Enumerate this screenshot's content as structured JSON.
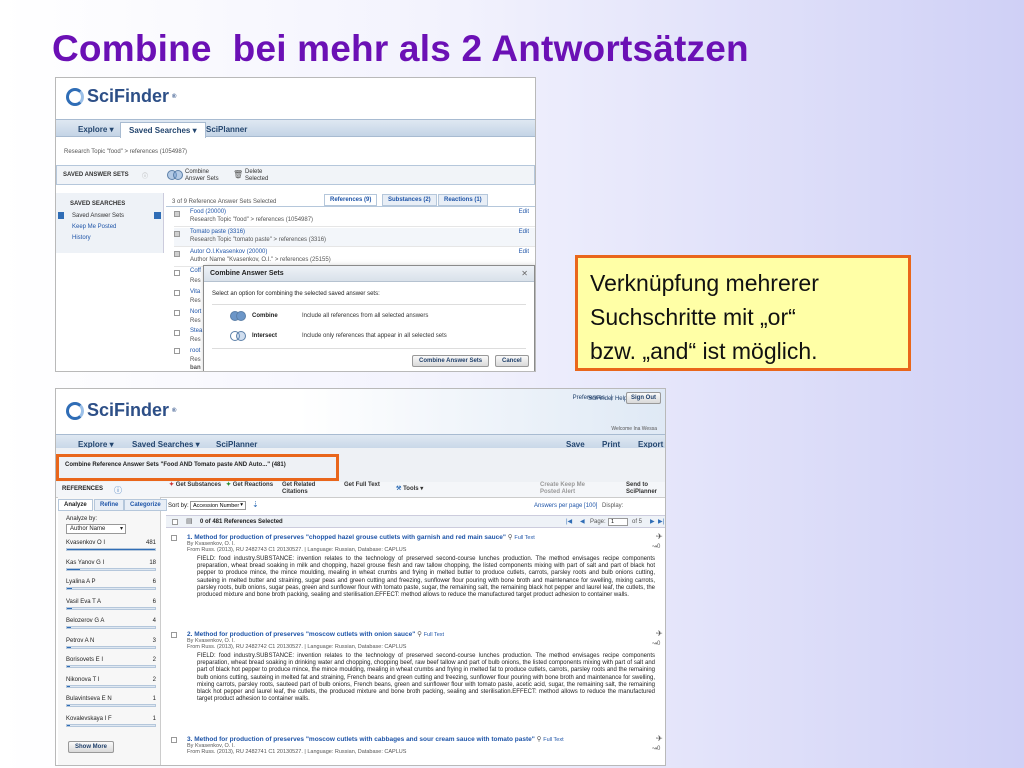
{
  "slide": {
    "title": "Combine  bei mehr als 2 Antwortsätzen",
    "note_lines": [
      "Verknüpfung mehrerer",
      "Suchschritte mit „or“",
      "bzw. „and“ ist möglich."
    ]
  },
  "brand": {
    "name": "SciFinder",
    "reg": "®"
  },
  "shot1": {
    "nav": [
      "Explore ▾",
      "Saved Searches ▾",
      "SciPlanner"
    ],
    "breadcrumb": "Research Topic \"food\" > references (1054987)",
    "section_label": "SAVED ANSWER SETS",
    "combine_tool": "Combine Answer Sets",
    "delete_tool": "Delete Selected",
    "sidebar_heading": "SAVED SEARCHES",
    "sidebar_items": [
      "Saved Answer Sets",
      "Keep Me Posted",
      "History"
    ],
    "selected_count": "3 of 9 Reference Answer Sets Selected",
    "tabs": [
      "References (9)",
      "Substances (2)",
      "Reactions (1)"
    ],
    "rows": [
      {
        "title": "Food (20000)",
        "sub": "Research Topic \"food\" > references (1054987)",
        "edit": "Edit"
      },
      {
        "title": "Tomato paste (3316)",
        "sub": "Research Topic \"tomato paste\" > references (3316)",
        "edit": "Edit"
      },
      {
        "title": "Autor O.I.Kvasenkov (20000)",
        "sub": "Author Name \"Kvasenkov, O.I.\" > references (25155)",
        "edit": "Edit"
      }
    ],
    "partial_rows": [
      "Coff",
      "Res",
      "Vita",
      "Res",
      "Nort",
      "Res",
      "Stea",
      "Res",
      "root",
      "Res",
      "ban"
    ],
    "dialog": {
      "title": "Combine Answer Sets",
      "prompt": "Select an option for combining the selected saved answer sets:",
      "options": [
        {
          "label": "Combine",
          "desc": "Include all references from all selected answers"
        },
        {
          "label": "Intersect",
          "desc": "Include only references that appear in all selected sets"
        }
      ],
      "primary": "Combine Answer Sets",
      "cancel": "Cancel"
    }
  },
  "shot2": {
    "top_links": [
      "Preferences",
      "|",
      "SciFinder Help ▾"
    ],
    "signout": "Sign Out",
    "nav": [
      "Explore ▾",
      "Saved Searches ▾",
      "SciPlanner"
    ],
    "right_nav": [
      "Save",
      "Print",
      "Export"
    ],
    "welcome": "Welcome Ina Wessa",
    "context": "Combine Reference Answer Sets \"Food AND Tomato paste AND Auto...\" (481)",
    "references_label": "REFERENCES",
    "tools": [
      "Get Substances",
      "Get Reactions",
      "Get Related Citations",
      "Get Full Text",
      "Tools ▾"
    ],
    "right_tools": [
      "Create Keep Me Posted Alert",
      "Send to SciPlanner"
    ],
    "left_tabs": [
      "Analyze",
      "Refine",
      "Categorize"
    ],
    "analyze_by": "Analyze by:",
    "analyze_value": "Author Name",
    "authors": [
      {
        "name": "Kvasenkov O I",
        "count": "481",
        "pct": 1.0
      },
      {
        "name": "Kas Yanov G I",
        "count": "18",
        "pct": 0.15
      },
      {
        "name": "Lyalina A P",
        "count": "6",
        "pct": 0.06
      },
      {
        "name": "Vasil Eva T A",
        "count": "6",
        "pct": 0.06
      },
      {
        "name": "Belozerov G A",
        "count": "4",
        "pct": 0.05
      },
      {
        "name": "Petrov A N",
        "count": "3",
        "pct": 0.04
      },
      {
        "name": "Borisovets E I",
        "count": "2",
        "pct": 0.03
      },
      {
        "name": "Nikonova T I",
        "count": "2",
        "pct": 0.03
      },
      {
        "name": "Bulavintseva E N",
        "count": "1",
        "pct": 0.02
      },
      {
        "name": "Kovalevskaya I F",
        "count": "1",
        "pct": 0.02
      }
    ],
    "show_more": "Show More",
    "sort_label": "Sort by:",
    "sort_value": "Accession Number",
    "answers_label": "Answers per page [100]",
    "display_label": "Display:",
    "page_label": "Page:",
    "page_value": "1",
    "page_of": "of 5",
    "selected": "0 of 481 References Selected",
    "records": [
      {
        "num": "1.",
        "title": "Method for production of preserves \"chopped hazel grouse cutlets with garnish and red main sauce\"",
        "fulltext": "Full Text",
        "by": "By Kvasenkov, O. I.",
        "from": "From Russ. (2013), RU 2482743 C1 20130527.  |  Language: Russian, Database: CAPLUS",
        "abstract": "FIELD: food industry.SUBSTANCE: invention relates to the technology of preserved second-course lunches production.  The method envisages recipe components preparation, wheat bread soaking in milk and chopping, hazel grouse flesh and raw tallow chopping, the listed components mixing with part of salt and part of black hot pepper to produce mince, the mince moulding, mealing in wheat crumbs and frying in melted butter to produce cutlets, carrots, parsley roots and bulb onions cutting, sauteing in melted butter and straining, sugar peas and green cutting and freezing, sunflower flour pouring with bone broth and maintenance for swelling, mixing carrots, parsley roots, bulb onions, sugar peas, green and sunflower flour with tomato paste, sugar, the remaining salt, the remaining black hot pepper and laurel leaf, the cutlets, the produced mixture and bone broth packing, sealing and sterilisation.EFFECT: method allows to reduce the manufactured target product adhesion to container walls."
      },
      {
        "num": "2.",
        "title": "Method for production of preserves \"moscow cutlets with onion sauce\"",
        "fulltext": "Full Text",
        "by": "By Kvasenkov, O. I.",
        "from": "From Russ. (2013), RU 2482742 C1 20130527.  |  Language: Russian, Database: CAPLUS",
        "abstract": "FIELD: food industry.SUBSTANCE: invention relates to the technology of preserved second-course lunches production.  The method envisages recipe components preparation, wheat bread soaking in drinking water and chopping, chopping beef, raw beef tallow and part of bulb onions, the listed components mixing with part of salt and part of black hot pepper to produce mince, the mince moulding, mealing in wheat crumbs and frying in melted fat to produce cutlets, carrots, parsley roots and the remaining bulb onions cutting, sauteing in melted fat and straining, French beans and green cutting and freezing, sunflower flour pouring with bone broth and maintenance for swelling, mixing carrots, parsley roots, sauteed part of bulb onions, French beans, green and sunflower flour with tomato paste, acetic acid, sugar, the remaining salt, the remaining black hot pepper and laurel leaf, the cutlets, the produced mixture and bone broth packing, sealing and sterilisation.EFFECT: method allows to reduce the manufactured target product adhesion to container walls."
      },
      {
        "num": "3.",
        "title": "Method for production of preserves \"moscow cutlets with cabbages and sour cream sauce with tomato paste\"",
        "fulltext": "Full Text",
        "by": "By Kvasenkov, O. I.",
        "from": "From Russ. (2013), RU 2482741 C1 20130527.  |  Language: Russian, Database: CAPLUS",
        "abstract": ""
      }
    ]
  },
  "colors": {
    "title": "#6b10b5",
    "highlight": "#e9661b",
    "note_bg": "#ffffa6",
    "link": "#1f55a8"
  }
}
